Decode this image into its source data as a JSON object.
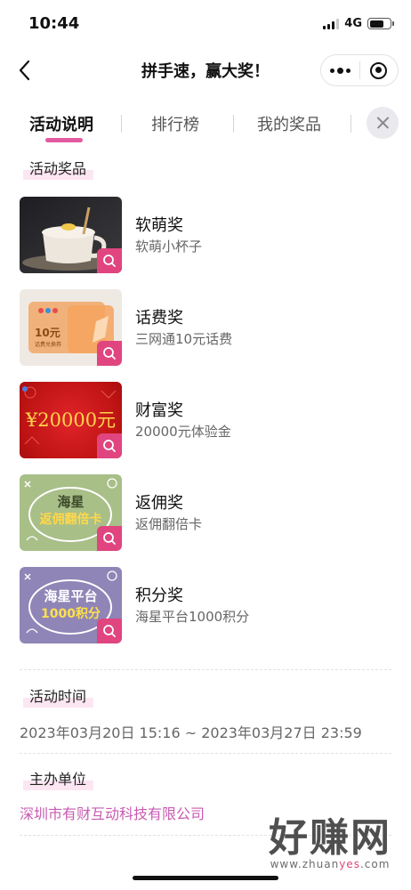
{
  "status_bar": {
    "time": "10:44",
    "network": "4G"
  },
  "nav": {
    "title": "拼手速，赢大奖！"
  },
  "tabs": [
    {
      "label": "活动说明",
      "active": true
    },
    {
      "label": "排行榜",
      "active": false
    },
    {
      "label": "我的奖品",
      "active": false
    }
  ],
  "sections": {
    "prizes": "活动奖品",
    "time": "活动时间",
    "organizer": "主办单位"
  },
  "prizes": [
    {
      "name": "软萌奖",
      "desc": "软萌小杯子",
      "icon": "cup-photo"
    },
    {
      "name": "话费奖",
      "desc": "三网通10元话费",
      "icon": "phone-credit-card",
      "image_text": {
        "value": "10元",
        "caption": "话费兑换券"
      }
    },
    {
      "name": "财富奖",
      "desc": "20000元体验金",
      "icon": "money-banner",
      "image_text": {
        "value": "¥20000元"
      }
    },
    {
      "name": "返佣奖",
      "desc": "返佣翻倍卡",
      "icon": "rebate-card",
      "image_text": {
        "top": "海星",
        "bottom": "返佣翻倍卡"
      }
    },
    {
      "name": "积分奖",
      "desc": "海星平台1000积分",
      "icon": "points-card",
      "image_text": {
        "top": "海星平台",
        "bottom": "1000积分"
      }
    }
  ],
  "activity_time": "2023年03月20日 15:16 ~ 2023年03月27日 23:59",
  "organizer": "深圳市有财互动科技有限公司",
  "watermark": {
    "big": "好赚网",
    "small_pre": "www.zhuan",
    "small_hl": "yes",
    "small_post": ".com"
  },
  "colors": {
    "accent": "#e0457f",
    "tab_underline": "#e35aa0",
    "link": "#c75bb0",
    "label_highlight": "#fce6f1"
  }
}
